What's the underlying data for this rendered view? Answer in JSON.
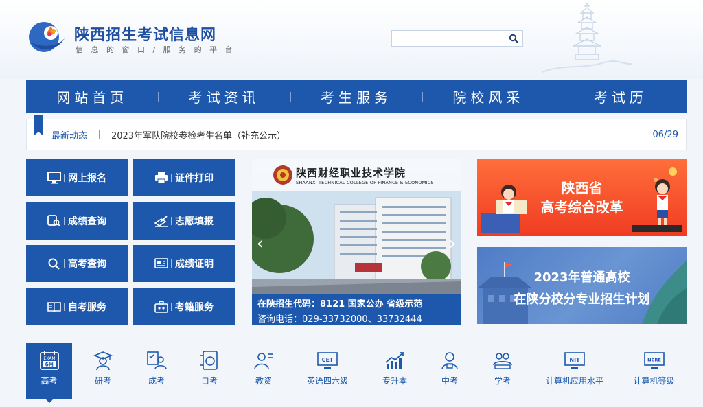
{
  "header": {
    "title": "陕西招生考试信息网",
    "slogan": "信 息 的 窗 口 / 服 务 的 平 台",
    "search_placeholder": ""
  },
  "nav": {
    "items": [
      "网站首页",
      "考试资讯",
      "考生服务",
      "院校风采",
      "考试历"
    ]
  },
  "news": {
    "label": "最新动态",
    "text": "2023年军队院校参检考生名单（补充公示）",
    "date": "06/29"
  },
  "services": [
    {
      "label": "网上报名",
      "icon": "monitor-icon"
    },
    {
      "label": "证件打印",
      "icon": "printer-icon"
    },
    {
      "label": "成绩查询",
      "icon": "score-search-icon"
    },
    {
      "label": "志愿填报",
      "icon": "form-pen-icon"
    },
    {
      "label": "高考查询",
      "icon": "search-icon"
    },
    {
      "label": "成绩证明",
      "icon": "certificate-icon"
    },
    {
      "label": "自考服务",
      "icon": "book-icon"
    },
    {
      "label": "考籍服务",
      "icon": "briefcase-icon"
    }
  ],
  "banner": {
    "school_cn": "陕西财经职业技术学院",
    "school_en": "SHAANXI TECHNICAL COLLEGE OF FINANCE & ECONOMICS",
    "line1": "在陕招生代码：8121  国家公办  省级示范",
    "line2": "咨询电话：029-33732000、33732444",
    "prev": "‹",
    "next": "›"
  },
  "promos": {
    "p1_line1": "陕西省",
    "p1_line2": "高考综合改革",
    "p2_line1": "2023年普通高校",
    "p2_line2": "在陕分校分专业招生计划"
  },
  "categories": [
    {
      "label": "高考",
      "icon": "exam-calendar-icon",
      "badge1": "EXAM",
      "badge2": "6月",
      "active": true
    },
    {
      "label": "研考",
      "icon": "graduate-icon"
    },
    {
      "label": "成考",
      "icon": "checklist-user-icon"
    },
    {
      "label": "自考",
      "icon": "self-study-icon"
    },
    {
      "label": "教资",
      "icon": "teacher-icon"
    },
    {
      "label": "英语四六级",
      "icon": "cet-icon",
      "badge1": "CET"
    },
    {
      "label": "专升本",
      "icon": "growth-chart-icon"
    },
    {
      "label": "中考",
      "icon": "student-icon"
    },
    {
      "label": "学考",
      "icon": "group-study-icon"
    },
    {
      "label": "计算机应用水平",
      "icon": "nit-icon",
      "badge1": "NIT"
    },
    {
      "label": "计算机等级",
      "icon": "ncre-icon",
      "badge1": "NCRE"
    }
  ],
  "colors": {
    "primary": "#1d58ac",
    "promo_red": "#f03c22",
    "promo_blue": "#5b86cc"
  }
}
